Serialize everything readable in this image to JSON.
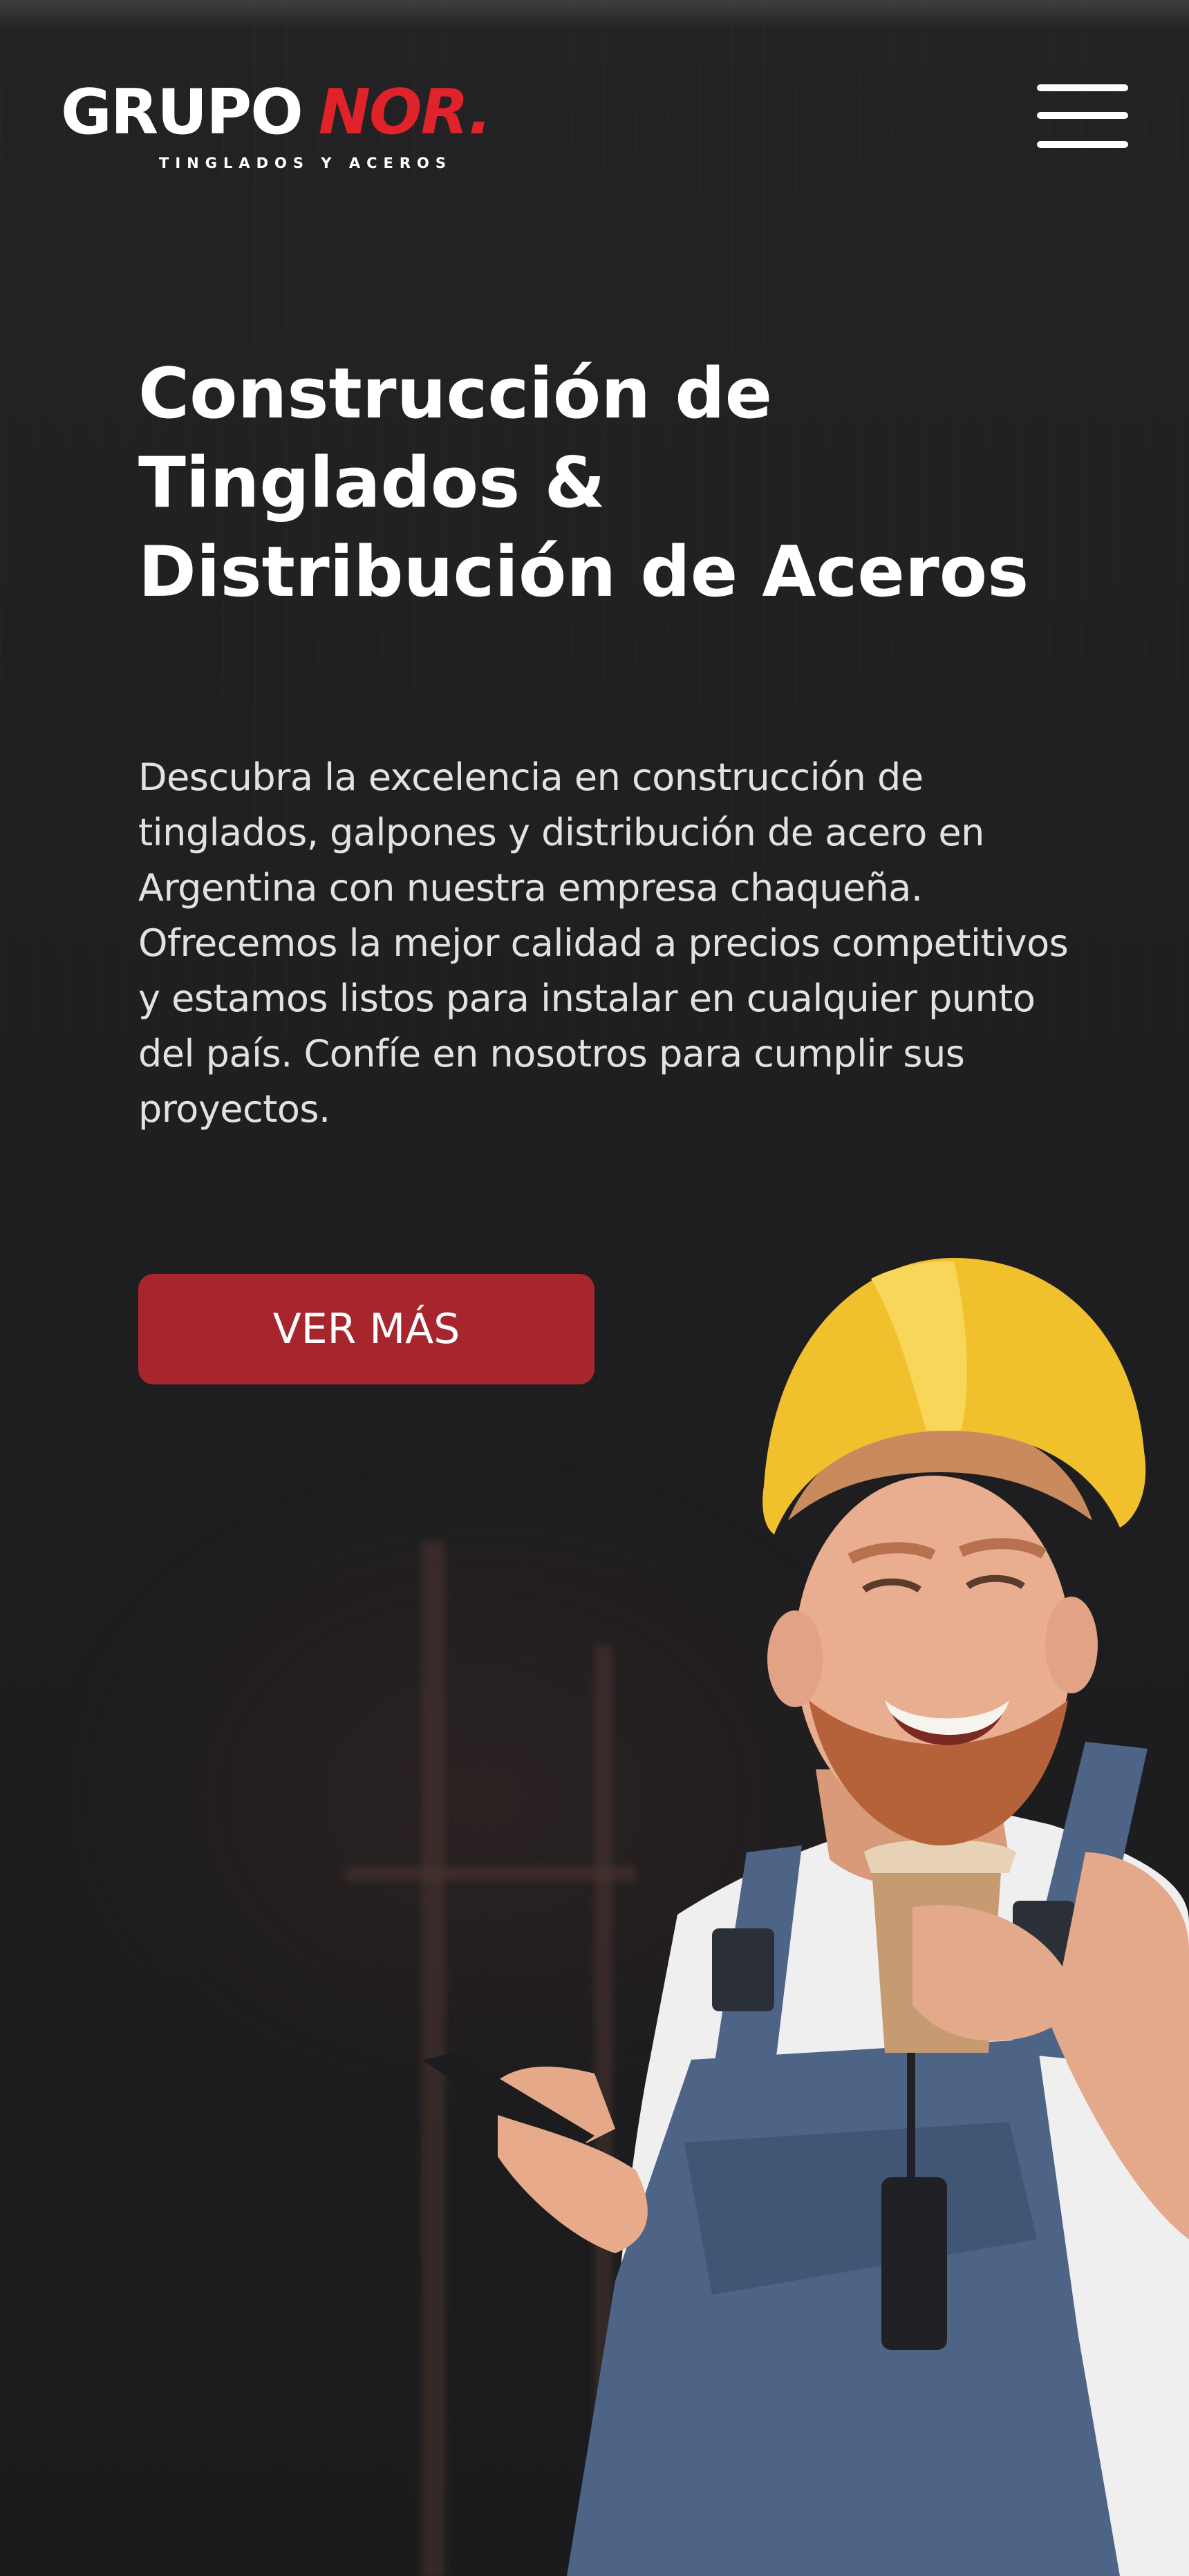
{
  "header": {
    "logo_primary": "GRUPO",
    "logo_accent": "NOR.",
    "logo_tagline": "TINGLADOS Y ACEROS",
    "menu_icon": "hamburger-menu-icon"
  },
  "hero": {
    "title": "Construcción de Tinglados & Distribución de Aceros",
    "description": "Descubra la excelencia en construcción de tinglados, galpones y distribución de acero en Argentina con nuestra empresa chaqueña. Ofrecemos la mejor calidad a precios competitivos y estamos listos para instalar en cualquier punto del país. Confíe en nosotros para cumplir sus proyectos.",
    "cta_label": "VER MÁS",
    "image": "construction-worker-with-helmet-coffee-and-phone"
  },
  "colors": {
    "background": "#1f1f21",
    "accent_red": "#e0232b",
    "button_red": "#a7262d",
    "text_white": "#ffffff"
  }
}
